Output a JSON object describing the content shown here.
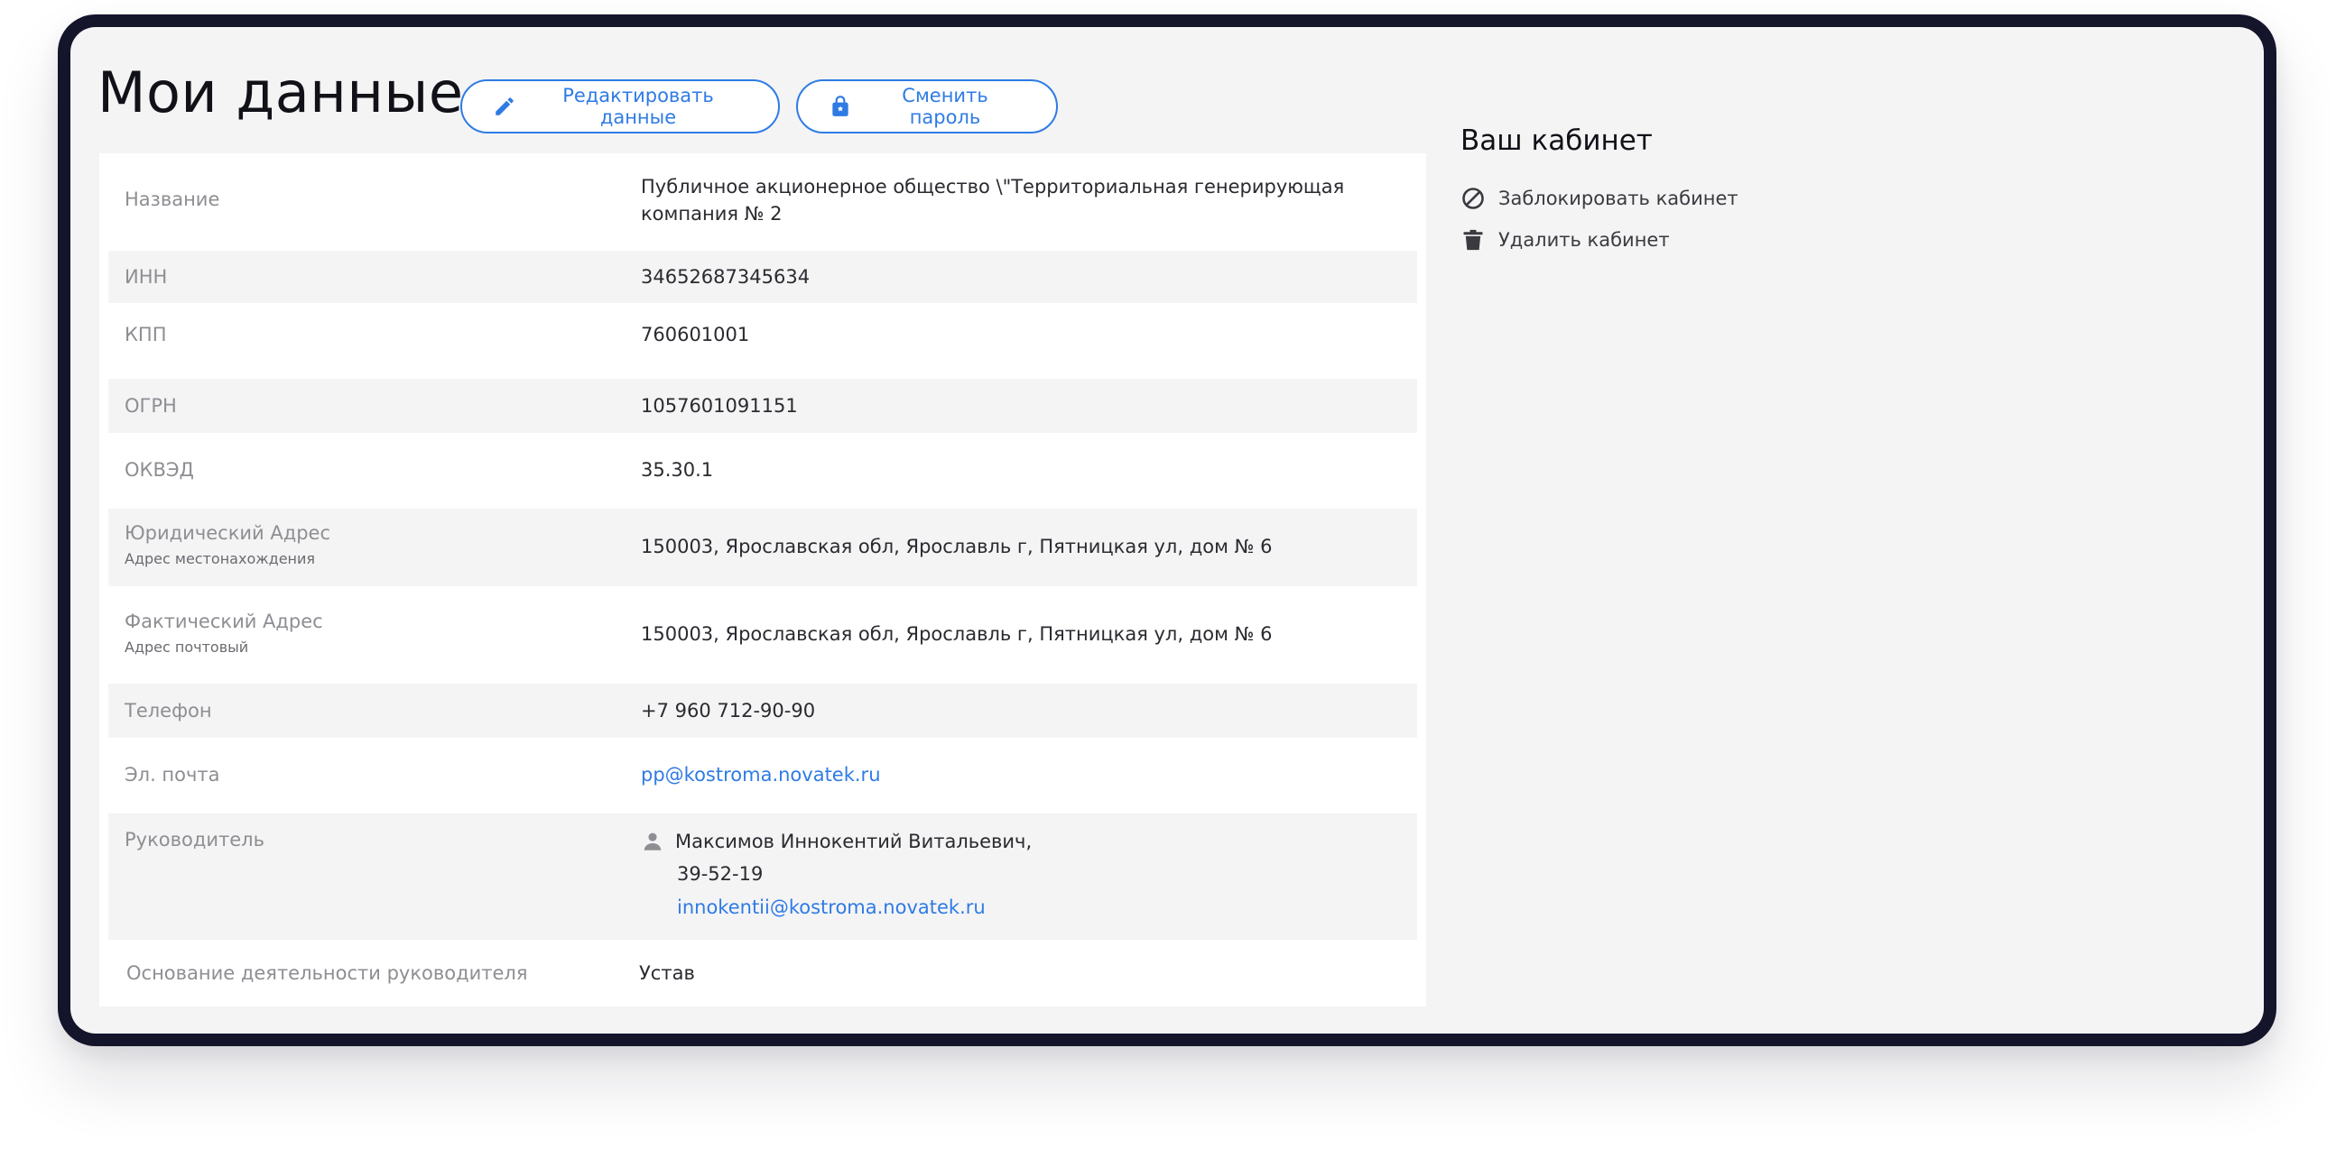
{
  "header": {
    "title": "Мои данные",
    "edit_button": "Редактировать данные",
    "password_button": "Сменить пароль"
  },
  "details": {
    "name": {
      "label": "Название",
      "value": "Публичное акционерное общество \\\"Территориальная генерирующая компания № 2"
    },
    "inn": {
      "label": "ИНН",
      "value": "34652687345634"
    },
    "kpp": {
      "label": "КПП",
      "value": "760601001"
    },
    "ogrn": {
      "label": "ОГРН",
      "value": "1057601091151"
    },
    "okved": {
      "label": "ОКВЭД",
      "value": "35.30.1"
    },
    "legal_address": {
      "label": "Юридический Адрес",
      "sublabel": "Адрес местонахождения",
      "value": "150003, Ярославская обл, Ярославль г, Пятницкая ул, дом № 6"
    },
    "actual_address": {
      "label": "Фактический Адрес",
      "sublabel": "Адрес почтовый",
      "value": "150003, Ярославская обл, Ярославль г, Пятницкая ул, дом № 6"
    },
    "phone": {
      "label": "Телефон",
      "value": "+7 960 712-90-90"
    },
    "email": {
      "label": "Эл. почта",
      "value": "pp@kostroma.novatek.ru"
    },
    "director": {
      "label": "Руководитель",
      "name": "Максимов Иннокентий Витальевич,",
      "phone": "39-52-19",
      "email": "innokentii@kostroma.novatek.ru"
    },
    "director_basis": {
      "label": "Основание деятельности руководителя",
      "value": "Устав"
    }
  },
  "sidebar": {
    "title": "Ваш кабинет",
    "block_label": "Заблокировать кабинет",
    "delete_label": "Удалить кабинет"
  },
  "colors": {
    "accent": "#2f7be4",
    "frame": "#14142b",
    "background": "#f4f4f5"
  },
  "icons": {
    "edit": "pencil-icon",
    "password": "lock-icon",
    "director": "person-icon",
    "block": "block-icon",
    "delete": "trash-icon"
  }
}
